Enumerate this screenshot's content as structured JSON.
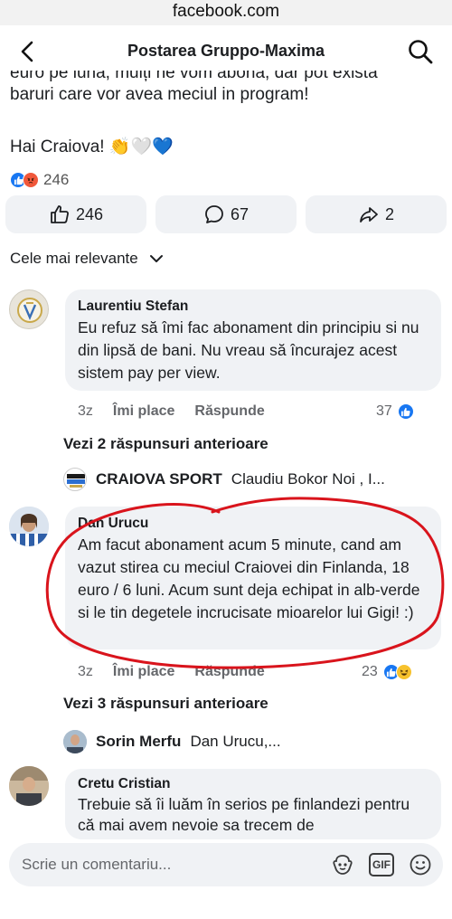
{
  "browser": {
    "url": "facebook.com"
  },
  "header": {
    "title": "Postarea Gruppo-Maxima",
    "back_icon": "chevron-left-icon",
    "search_icon": "search-icon"
  },
  "post": {
    "text_line1": "euro pe lună, mulți ne vom abona, dar pot exista",
    "text_line2": "baruri care vor avea meciul in program!",
    "text_line3": "Hai Craiova! 👏🤍💙",
    "reaction_count": "246"
  },
  "actions": {
    "like_count": "246",
    "comment_count": "67",
    "share_count": "2"
  },
  "sort": {
    "label": "Cele mai relevante"
  },
  "comments": [
    {
      "author": "Laurentiu Stefan",
      "text": "Eu refuz să îmi fac abonament din principiu si nu din lipsă de bani. Nu vreau să încurajez acest sistem pay per view.",
      "time": "3z",
      "like_label": "Îmi place",
      "reply_label": "Răspunde",
      "reactions": "37",
      "view_more": "Vezi 2 răspunsuri anterioare",
      "reply_preview": {
        "author": "CRAIOVA SPORT",
        "text": "Claudiu Bokor Noi , I..."
      }
    },
    {
      "author": "Dan Urucu",
      "text": "Am facut abonament acum 5 minute, cand am vazut stirea cu meciul Craiovei din Finlanda,   18 euro / 6 luni. Acum sunt deja echipat in alb-verde si le tin degetele incrucisate mioarelor lui Gigi! :)",
      "time": "3z",
      "like_label": "Îmi place",
      "reply_label": "Răspunde",
      "reactions": "23",
      "view_more": "Vezi 3 răspunsuri anterioare",
      "reply_preview": {
        "author": "Sorin Merfu",
        "text": "Dan Urucu,..."
      }
    },
    {
      "author": "Cretu Cristian",
      "text": "Trebuie să îi luăm în serios pe finlandezi pentru că mai avem nevoie sa trecem de"
    }
  ],
  "composer": {
    "placeholder": "Scrie un comentariu...",
    "gif_label": "GIF"
  },
  "colors": {
    "blue": "#1877f2",
    "bubble": "#f0f2f5",
    "annotation_red": "#d9141c"
  }
}
